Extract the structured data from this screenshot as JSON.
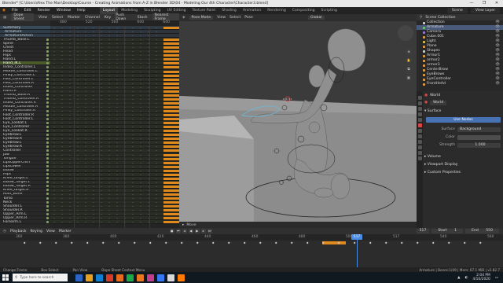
{
  "window": {
    "title": "Blender* [C:\\Users\\Alex The Man\\Desktop\\Course - Creating Animations from A-Z in Blender 3D\\04 - Modeling Our 4th Character\\Character3.blend]",
    "controls": [
      "—",
      "❐",
      "✕"
    ]
  },
  "menubar": {
    "menus": [
      "File",
      "Edit",
      "Render",
      "Window",
      "Help"
    ],
    "workspaces": [
      "Layout",
      "Modeling",
      "Sculpting",
      "UV Editing",
      "Texture Paint",
      "Shading",
      "Animation",
      "Rendering",
      "Compositing",
      "Scripting"
    ],
    "active_workspace": "Layout",
    "scene": "Scene",
    "view_layer": "View Layer"
  },
  "dopesheet": {
    "mode": "Dope Sheet",
    "menus": [
      "View",
      "Select",
      "Marker",
      "Channel",
      "Key"
    ],
    "push_down": "Push Down",
    "stash": "Stash",
    "interpolation": "Nearest Frame",
    "ruler": [
      "480",
      "520",
      "560",
      "600",
      "640"
    ],
    "channels": [
      {
        "label": "Summary",
        "kind": "sum"
      },
      {
        "label": "Armature",
        "kind": "arm"
      },
      {
        "label": "ArmatureAction",
        "kind": "arm"
      },
      {
        "label": "Thumb_Base.L",
        "kind": "ch"
      },
      {
        "label": "Spine",
        "kind": "ch"
      },
      {
        "label": "Chest",
        "kind": "ch"
      },
      {
        "label": "Head",
        "kind": "ch"
      },
      {
        "label": "Hips",
        "kind": "ch"
      },
      {
        "label": "Hand.L",
        "kind": "ch"
      },
      {
        "label": "Hand_IK.L",
        "kind": "sel"
      },
      {
        "label": "Index_Controller.L",
        "kind": "ch"
      },
      {
        "label": "Middle_Controller.L",
        "kind": "ch"
      },
      {
        "label": "Pinky_Controller.L",
        "kind": "ch"
      },
      {
        "label": "Foot_Controller.L",
        "kind": "ch"
      },
      {
        "label": "Foot_Controller.R",
        "kind": "ch"
      },
      {
        "label": "Index_Controller",
        "kind": "ch"
      },
      {
        "label": "Hand.R",
        "kind": "ch"
      },
      {
        "label": "Thumb_Base.R",
        "kind": "ch"
      },
      {
        "label": "Thumb_Controller.R",
        "kind": "ch"
      },
      {
        "label": "Index_Controller.R",
        "kind": "ch"
      },
      {
        "label": "Middle_Controller.R",
        "kind": "ch"
      },
      {
        "label": "Pinky_Controller.R",
        "kind": "ch"
      },
      {
        "label": "Foot_Controller.R",
        "kind": "ch"
      },
      {
        "label": "Foot_Controller.L",
        "kind": "ch"
      },
      {
        "label": "Eye_Lookat.L",
        "kind": "ch"
      },
      {
        "label": "Eye_Controller",
        "kind": "ch"
      },
      {
        "label": "Eye_Lookat.R",
        "kind": "ch"
      },
      {
        "label": "Eyebrow.L",
        "kind": "ch"
      },
      {
        "label": "Eyebrow.R",
        "kind": "ch"
      },
      {
        "label": "Eyebrow.L",
        "kind": "ch"
      },
      {
        "label": "Eyebrow.R",
        "kind": "ch"
      },
      {
        "label": "Controller",
        "kind": "ch"
      },
      {
        "label": "Jaw",
        "kind": "ch"
      },
      {
        "label": "Tongue",
        "kind": "ch"
      },
      {
        "label": "LipsUpperCntrl",
        "kind": "ch"
      },
      {
        "label": "LipsLower",
        "kind": "ch"
      },
      {
        "label": "Elbow",
        "kind": "ch"
      },
      {
        "label": "Hips",
        "kind": "ch"
      },
      {
        "label": "Knee_target.L",
        "kind": "ch"
      },
      {
        "label": "Elbow_Target.L",
        "kind": "ch"
      },
      {
        "label": "Elbow_Target.R",
        "kind": "ch"
      },
      {
        "label": "Knee_target.R",
        "kind": "ch"
      },
      {
        "label": "Root_Bone",
        "kind": "ch"
      },
      {
        "label": "Torso",
        "kind": "ch"
      },
      {
        "label": "Neck",
        "kind": "ch"
      },
      {
        "label": "Shoulder.L",
        "kind": "ch"
      },
      {
        "label": "Shoulder.R",
        "kind": "ch"
      },
      {
        "label": "Upper_Arm.L",
        "kind": "ch"
      },
      {
        "label": "Upper_Arm.R",
        "kind": "ch"
      },
      {
        "label": "Forearm.L",
        "kind": "ch"
      }
    ]
  },
  "viewport": {
    "mode": "Pose Mode",
    "menus": [
      "View",
      "Select",
      "Pose"
    ],
    "orientation": "Global",
    "perspective": "User Perspective",
    "object_info": "(517) Armature : Hand_IK.L",
    "footer": "Move"
  },
  "outliner": {
    "title": "Scene Collection",
    "items": [
      {
        "label": "Collection",
        "color": "#cfcfcf",
        "selected": false
      },
      {
        "label": "Armature",
        "color": "#66cc66",
        "selected": true
      },
      {
        "label": "Camera",
        "color": "#9a7ad9",
        "selected": false
      },
      {
        "label": "Cube.001",
        "color": "#e0a040",
        "selected": false
      },
      {
        "label": "Light",
        "color": "#e0c040",
        "selected": false
      },
      {
        "label": "Plane",
        "color": "#e0a040",
        "selected": false
      },
      {
        "label": "Shapes",
        "color": "#cfcfcf",
        "selected": false
      },
      {
        "label": "Armor1",
        "color": "#e0a040",
        "selected": false
      },
      {
        "label": "armor2",
        "color": "#e0a040",
        "selected": false
      },
      {
        "label": "armor3",
        "color": "#e0a040",
        "selected": false
      },
      {
        "label": "CenterBrow",
        "color": "#e0a040",
        "selected": false
      },
      {
        "label": "EyeBrows",
        "color": "#e0a040",
        "selected": false
      },
      {
        "label": "EyeController",
        "color": "#e0a040",
        "selected": false
      },
      {
        "label": "FrontHeAd",
        "color": "#e0a040",
        "selected": false
      }
    ]
  },
  "properties": {
    "header_world": "World",
    "world_name": "World",
    "surface_title": "Surface",
    "use_nodes": "Use Nodes",
    "surface_label": "Surface",
    "surface_value": "Background",
    "color_label": "Color",
    "strength_label": "Strength",
    "strength_value": "1.000",
    "sections": [
      "Volume",
      "Viewport Display",
      "Custom Properties"
    ]
  },
  "timeline": {
    "menus": [
      "Playback",
      "Keying",
      "View",
      "Marker"
    ],
    "current_frame": "517",
    "start_label": "Start",
    "start": "1",
    "end_label": "End",
    "end": "550",
    "ruler": [
      "360",
      "380",
      "400",
      "420",
      "440",
      "460",
      "480",
      "500",
      "517",
      "540",
      "560"
    ],
    "playhead_label": "517"
  },
  "statusbar": {
    "items": [
      "Change Frame",
      "Box Select",
      "Pan View",
      "Dope Sheet Context Menu"
    ],
    "stats": "Armature | Bones:1/49 | Mem: 67.1 MiB | v2.82.7"
  },
  "taskbar": {
    "search_placeholder": "Type here to search",
    "time": "2:04 PM",
    "date": "4/10/2020",
    "apps": [
      "#2b64c4",
      "#e8a020",
      "#0f7fd4",
      "#d63b2a",
      "#e86a1c",
      "#1da84a",
      "#ea7620",
      "#c43c8e",
      "#3478f6",
      "#d8d8d8",
      "#ff7a00"
    ]
  },
  "colors": {
    "accent": "#4772b3",
    "key_orange": "#e08a1e",
    "playhead": "#4b8ce6",
    "selection_green": "#4b5a2b"
  }
}
